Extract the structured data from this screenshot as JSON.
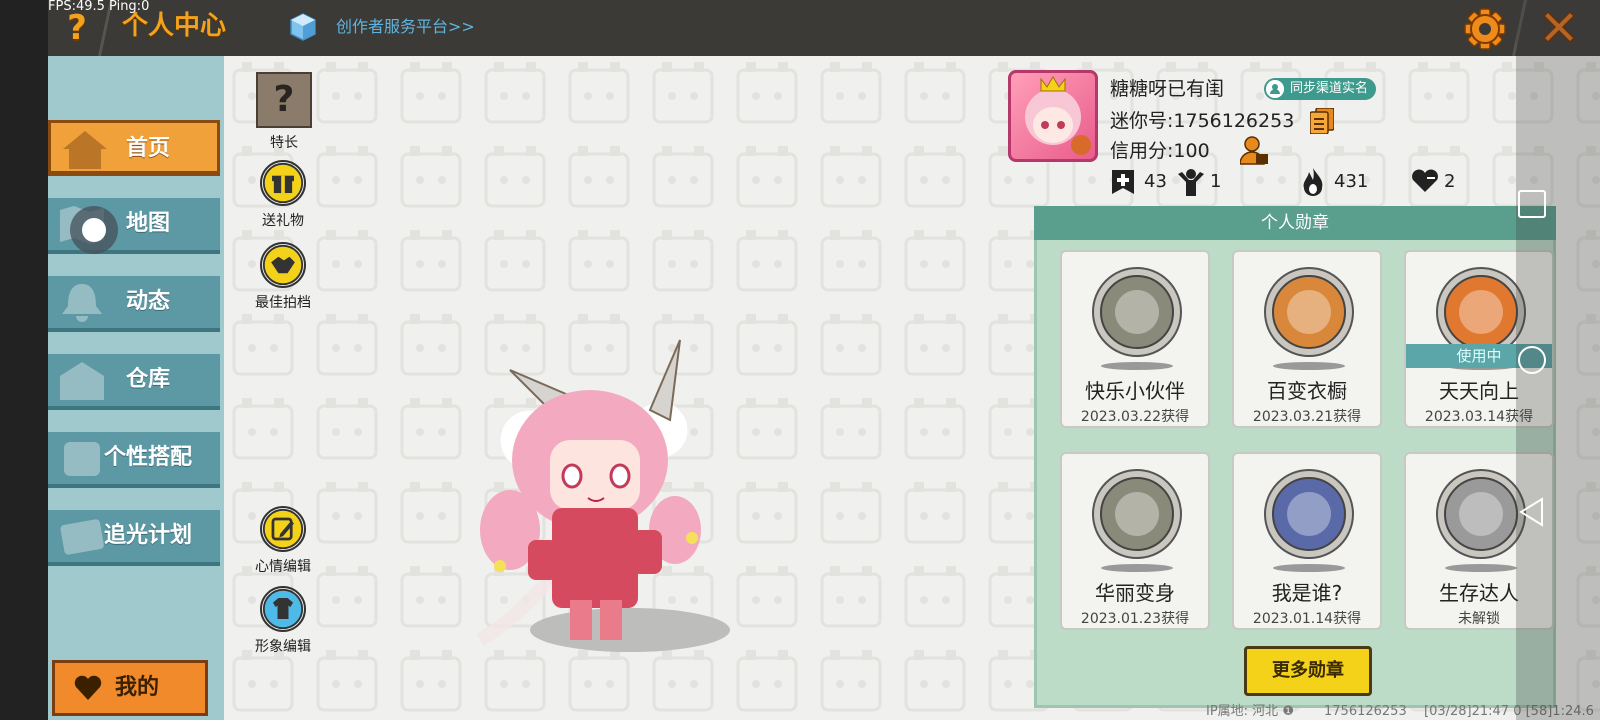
{
  "debug": {
    "fps_text": "FPS:49.5  Ping:0"
  },
  "header": {
    "title": "个人中心",
    "creator_link": "创作者服务平台>>",
    "help_icon": "question-mark-icon",
    "settings_icon": "gear-icon",
    "close_icon": "close-icon",
    "accent_color": "#f2a21c"
  },
  "sidebar": {
    "items": [
      {
        "label": "首页",
        "icon": "house-icon",
        "active": true
      },
      {
        "label": "地图",
        "icon": "map-icon",
        "active": false
      },
      {
        "label": "动态",
        "icon": "bell-icon",
        "active": false
      },
      {
        "label": "仓库",
        "icon": "warehouse-icon",
        "active": false
      },
      {
        "label": "个性搭配",
        "icon": "outfit-icon",
        "active": false
      },
      {
        "label": "追光计划",
        "icon": "plan-icon",
        "active": false
      }
    ],
    "my_button": "我的"
  },
  "actions": {
    "skill": "特长",
    "send_gift": "送礼物",
    "best_partner": "最佳拍档",
    "mood_edit": "心情编辑",
    "avatar_edit": "形象编辑"
  },
  "profile": {
    "username": "糖糖呀已有闺",
    "sync_badge": "同步渠道实名",
    "mini_id": "迷你号:1756126253",
    "credit": "信用分:100",
    "stats": [
      {
        "icon": "add-bookmark-icon",
        "value": "43"
      },
      {
        "icon": "fans-icon",
        "value": "1"
      },
      {
        "icon": "flame-icon",
        "value": "431"
      },
      {
        "icon": "heart-icon",
        "value": "2"
      }
    ]
  },
  "badges": {
    "title": "个人勋章",
    "in_use_label": "使用中",
    "items": [
      {
        "name": "快乐小伙伴",
        "date": "2023.03.22获得",
        "color": "#8a8a7a"
      },
      {
        "name": "百变衣橱",
        "date": "2023.03.21获得",
        "color": "#d9883b"
      },
      {
        "name": "天天向上",
        "date": "2023.03.14获得",
        "color": "#e0782f",
        "in_use": true
      },
      {
        "name": "华丽变身",
        "date": "2023.01.23获得",
        "color": "#8a8a7a"
      },
      {
        "name": "我是谁?",
        "date": "2023.01.14获得",
        "color": "#5a6aa8"
      },
      {
        "name": "生存达人",
        "date": "未解锁",
        "color": "#9a9a9a"
      }
    ],
    "more_button": "更多勋章"
  },
  "footer": {
    "ip": "IP属地: 河北 ❶",
    "id": "1756126253",
    "time": "[03/28]21:47 0 [58]1:24.6"
  }
}
